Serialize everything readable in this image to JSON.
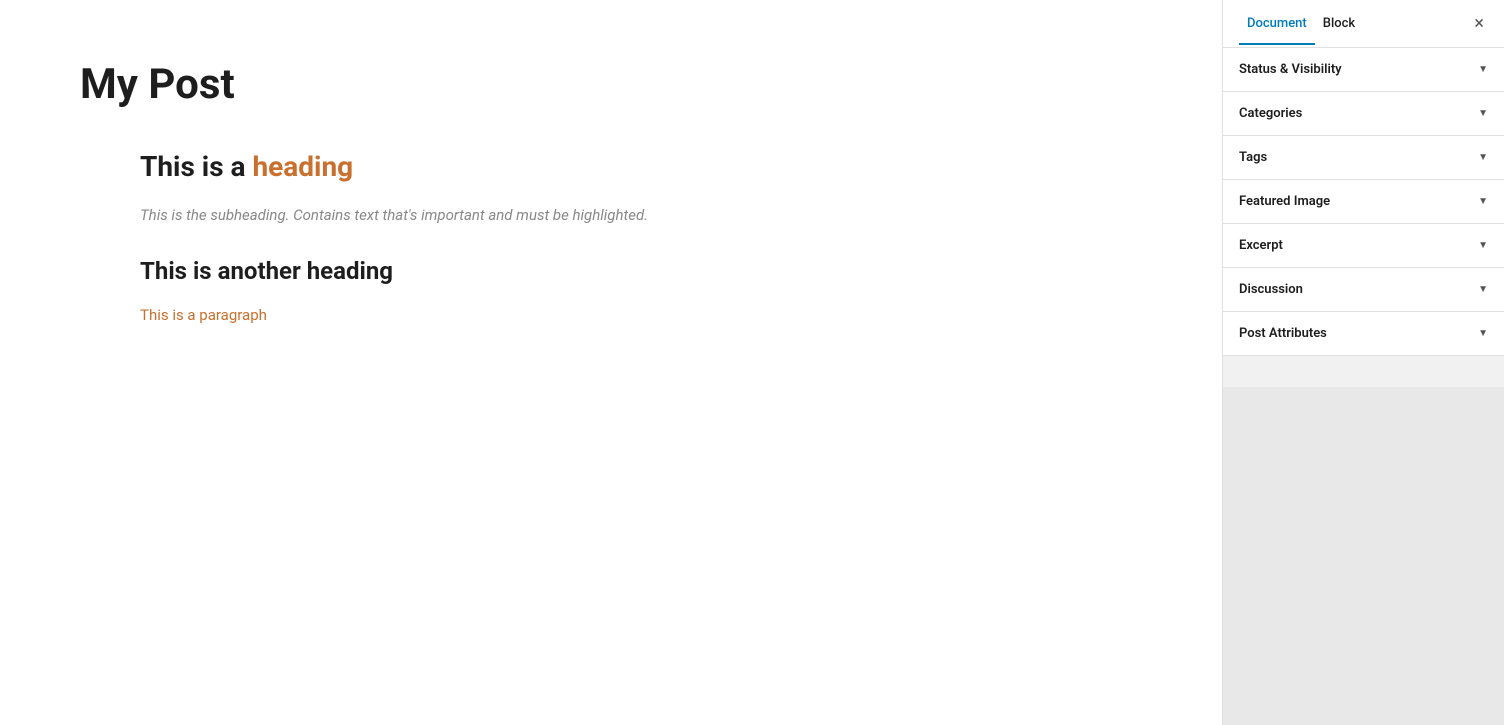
{
  "main": {
    "post_title": "My Post",
    "heading1_prefix": "This is a ",
    "heading1_highlight": "heading",
    "subheading": "This is the subheading. Contains text that's important and must be highlighted.",
    "heading2": "This is another heading",
    "paragraph": "This is a paragraph"
  },
  "sidebar": {
    "tab_document": "Document",
    "tab_block": "Block",
    "close_label": "×",
    "panels": [
      {
        "label": "Status & Visibility"
      },
      {
        "label": "Categories"
      },
      {
        "label": "Tags"
      },
      {
        "label": "Featured Image"
      },
      {
        "label": "Excerpt"
      },
      {
        "label": "Discussion"
      },
      {
        "label": "Post Attributes"
      }
    ]
  }
}
